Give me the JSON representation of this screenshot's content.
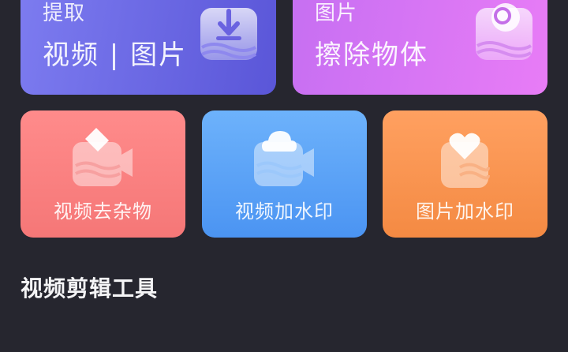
{
  "cards": {
    "extract": {
      "subtitle": "提取",
      "title": "视频 | 图片",
      "icon": "download-tray-icon",
      "colors": [
        "#7d7cf0",
        "#5a56d8"
      ]
    },
    "erase": {
      "subtitle": "图片",
      "title": "擦除物体",
      "icon": "image-erase-icon",
      "colors": [
        "#c66ff2",
        "#e87cf6"
      ]
    },
    "remove_video_object": {
      "label": "视频去杂物",
      "icon": "video-eraser-icon",
      "colors": [
        "#ff8b8b",
        "#f57777"
      ]
    },
    "video_watermark": {
      "label": "视频加水印",
      "icon": "video-cloud-icon",
      "colors": [
        "#6db2fb",
        "#4b94f2"
      ]
    },
    "image_watermark": {
      "label": "图片加水印",
      "icon": "image-heart-icon",
      "colors": [
        "#ffa060",
        "#f48a43"
      ]
    }
  },
  "sections": {
    "video_tools_title": "视频剪辑工具"
  },
  "theme": {
    "background": "#26262f"
  }
}
